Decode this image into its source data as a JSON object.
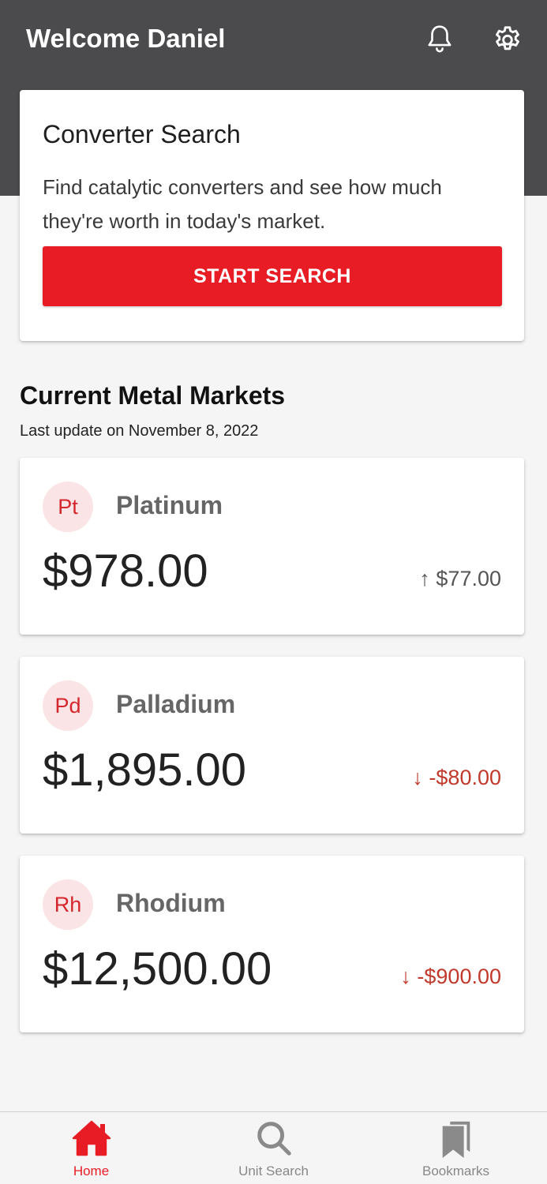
{
  "header": {
    "title": "Welcome Daniel",
    "icons": [
      "bell-icon",
      "gear-icon"
    ],
    "background": "#4b4b4d"
  },
  "search_card": {
    "title": "Converter Search",
    "description": "Find catalytic converters and see how much they're worth in today's market.",
    "button_label": "START SEARCH",
    "button_color": "#e81c25"
  },
  "markets": {
    "title": "Current Metal Markets",
    "last_update": "Last update on November 8, 2022",
    "items": [
      {
        "symbol": "Pt",
        "name": "Platinum",
        "price": "$978.00",
        "change": "↑ $77.00",
        "direction": "up"
      },
      {
        "symbol": "Pd",
        "name": "Palladium",
        "price": "$1,895.00",
        "change": "↓ -$80.00",
        "direction": "down"
      },
      {
        "symbol": "Rh",
        "name": "Rhodium",
        "price": "$12,500.00",
        "change": "↓ -$900.00",
        "direction": "down"
      }
    ]
  },
  "bottom_nav": {
    "items": [
      {
        "label": "Home",
        "icon": "home-icon",
        "active": true
      },
      {
        "label": "Unit Search",
        "icon": "search-icon",
        "active": false
      },
      {
        "label": "Bookmarks",
        "icon": "bookmark-icon",
        "active": false
      }
    ]
  },
  "colors": {
    "accent": "#e81c25",
    "badge_bg": "#fbe4e5",
    "down": "#c0392b"
  }
}
